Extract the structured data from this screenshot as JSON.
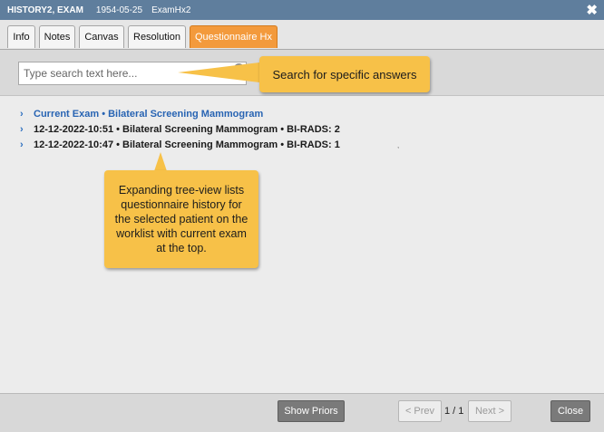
{
  "title_bar": {
    "patient_name": "HISTORY2, EXAM",
    "dob": "1954-05-25",
    "mrn": "ExamHx2",
    "close_glyph": "✖"
  },
  "tabs": [
    {
      "label": "Info",
      "active": false
    },
    {
      "label": "Notes",
      "active": false
    },
    {
      "label": "Canvas",
      "active": false
    },
    {
      "label": "Resolution",
      "active": false
    },
    {
      "label": "Questionnaire Hx",
      "active": true
    }
  ],
  "search": {
    "placeholder": "Type search text here...",
    "value": "",
    "clear_glyph": "✕"
  },
  "tree": {
    "chevron_glyph": "›",
    "items": [
      {
        "label": "Current Exam • Bilateral Screening Mammogram",
        "current": true
      },
      {
        "label": "12-12-2022-10:51 • Bilateral Screening Mammogram • BI-RADS: 2",
        "current": false
      },
      {
        "label": "12-12-2022-10:47 • Bilateral Screening Mammogram • BI-RADS: 1",
        "current": false
      }
    ]
  },
  "tiny_mark": ",",
  "callouts": {
    "search_tip": "Search for specific answers",
    "tree_tip": "Expanding tree-view lists questionnaire history for the selected patient on the worklist with current exam at the top."
  },
  "footer": {
    "show_priors": "Show Priors",
    "prev": "< Prev",
    "page_indicator": "1 / 1",
    "next": "Next >",
    "close": "Close"
  },
  "colors": {
    "title_bar": "#5f7e9d",
    "active_tab": "#f39a3c",
    "callout": "#f7c148",
    "link_blue": "#2864b3"
  }
}
